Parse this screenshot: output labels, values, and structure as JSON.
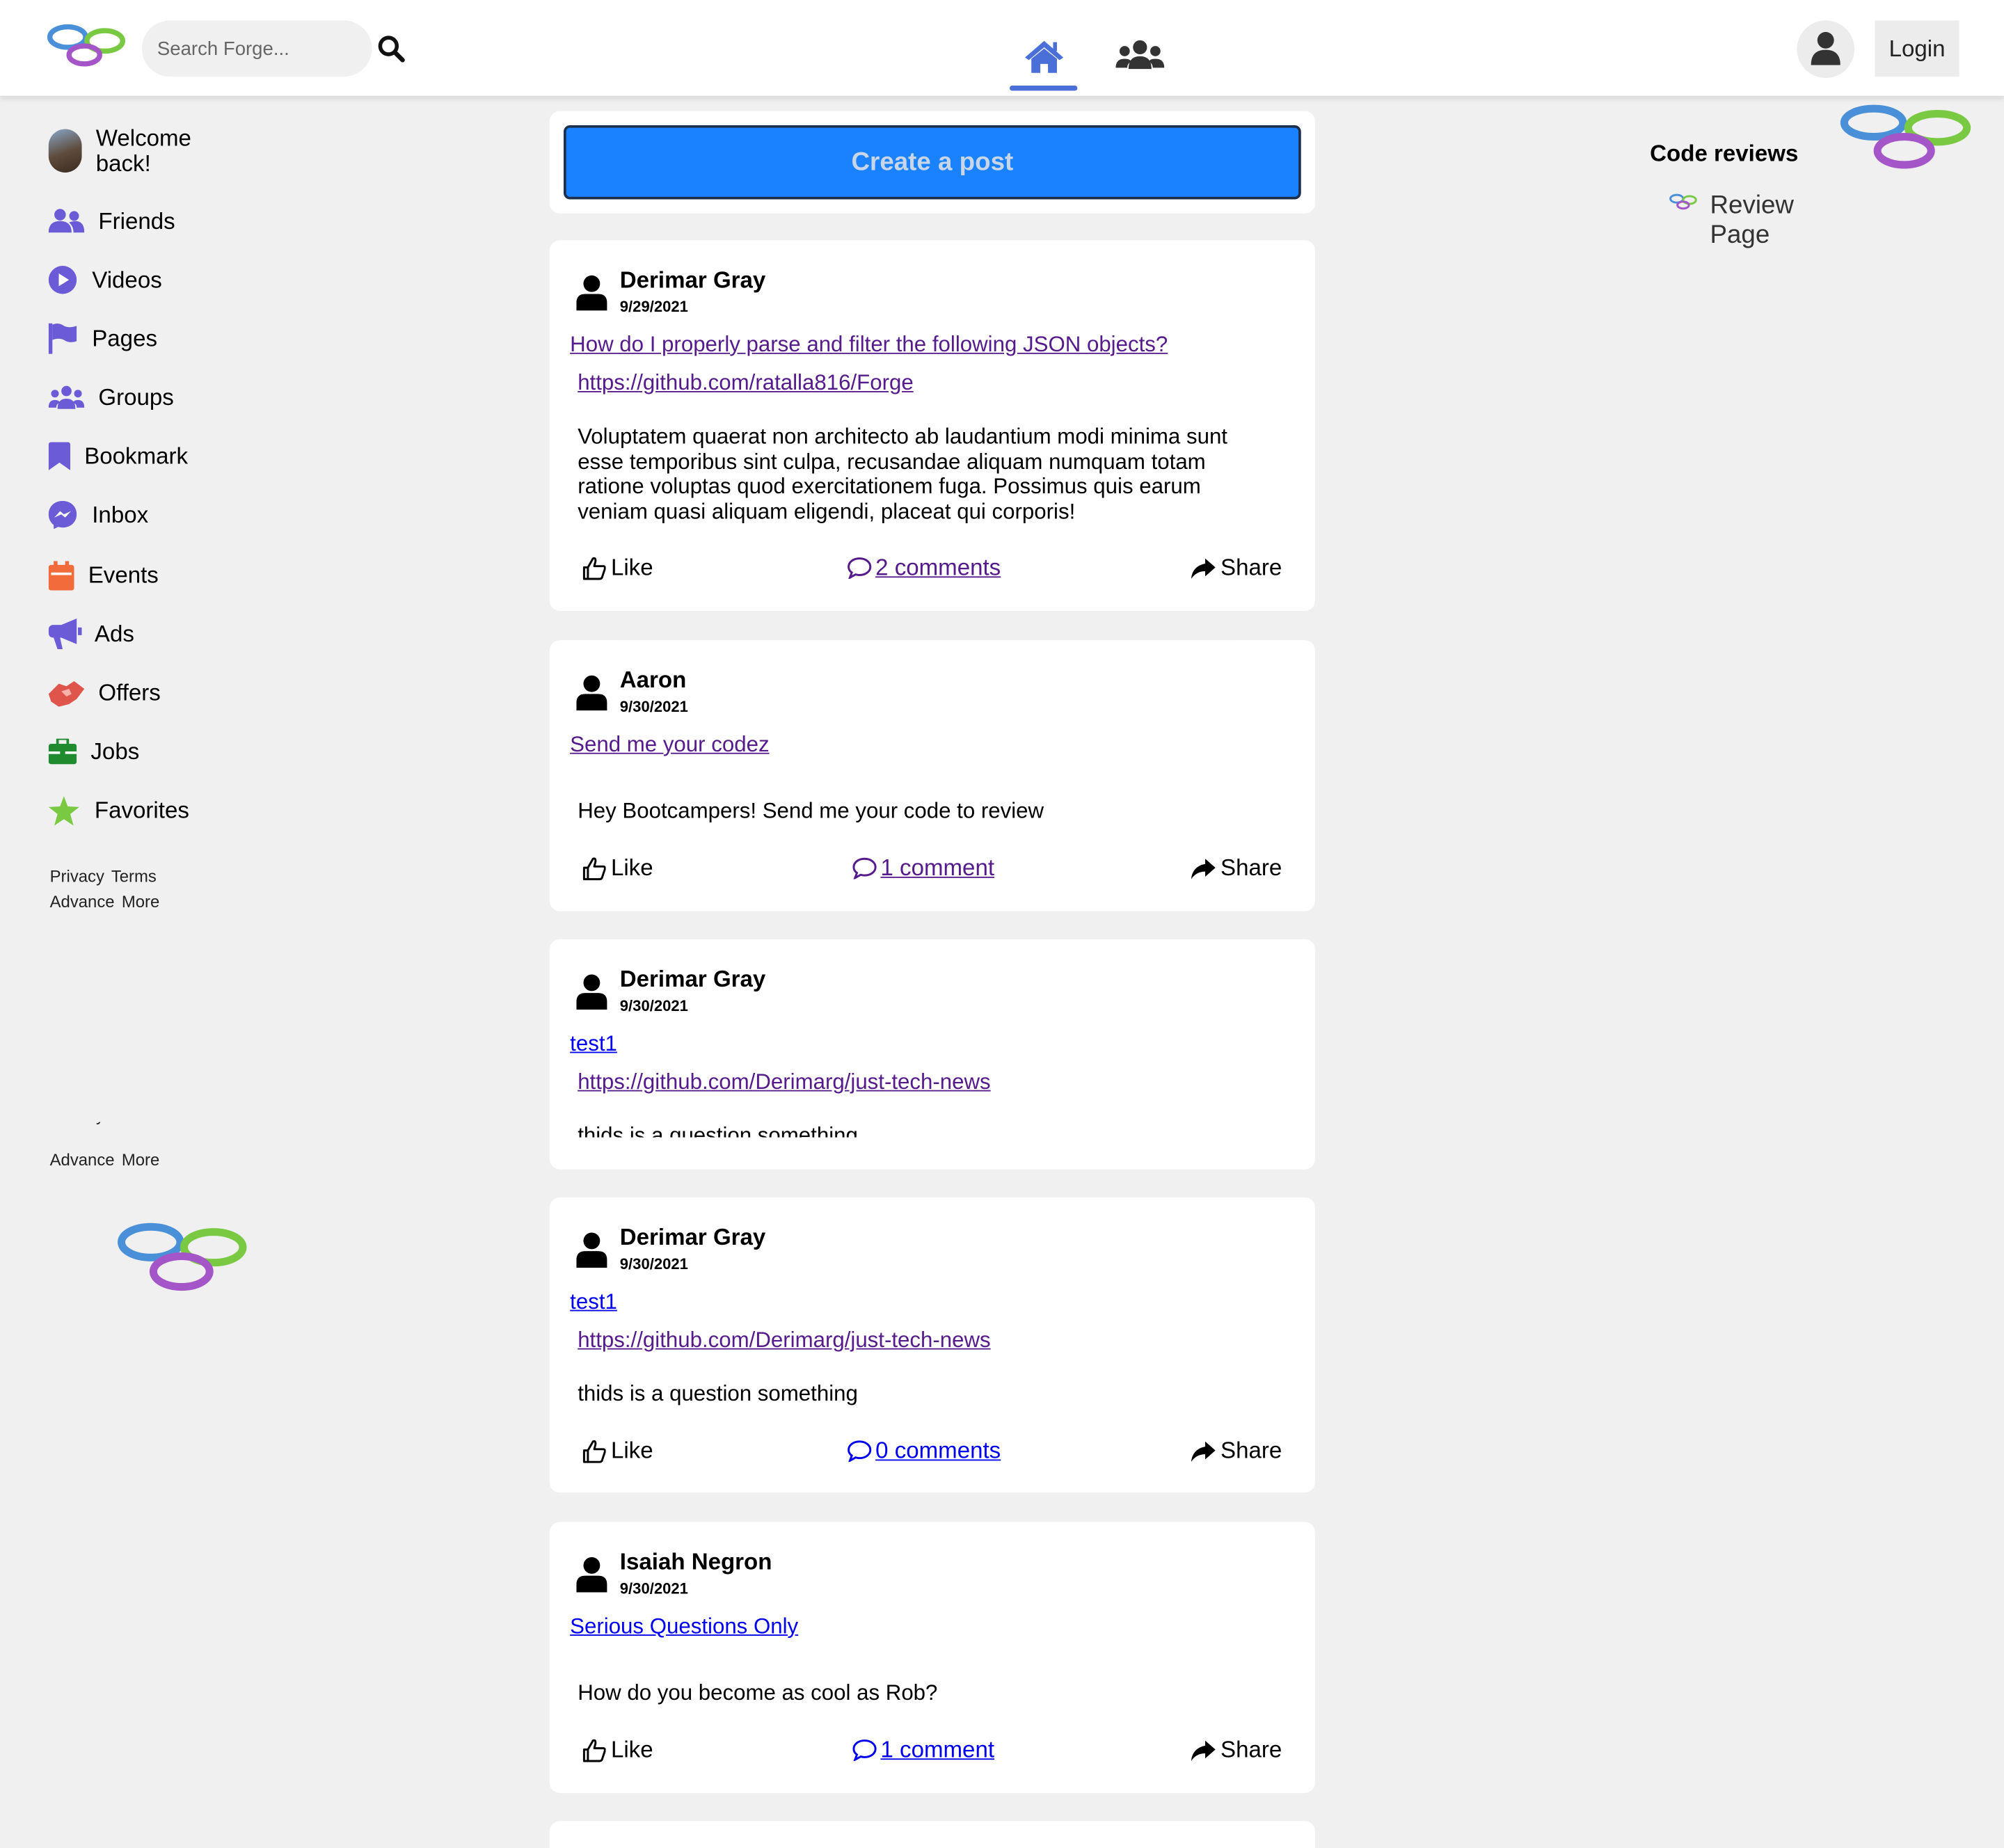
{
  "navbar": {
    "search_placeholder": "Search Forge...",
    "login_label": "Login"
  },
  "sidebar": {
    "welcome": "Welcome back!",
    "items": [
      {
        "label": "Friends",
        "icon": "user-friends-icon",
        "color": "#6b5bd6"
      },
      {
        "label": "Videos",
        "icon": "play-circle-icon",
        "color": "#6b5bd6"
      },
      {
        "label": "Pages",
        "icon": "flag-icon",
        "color": "#6b5bd6"
      },
      {
        "label": "Groups",
        "icon": "users-icon",
        "color": "#6b5bd6"
      },
      {
        "label": "Bookmark",
        "icon": "bookmark-icon",
        "color": "#6b5bd6"
      },
      {
        "label": "Inbox",
        "icon": "messenger-icon",
        "color": "#6b5bd6"
      },
      {
        "label": "Events",
        "icon": "calendar-icon",
        "color": "#f26b3a"
      },
      {
        "label": "Ads",
        "icon": "bullhorn-icon",
        "color": "#6b5bd6"
      },
      {
        "label": "Offers",
        "icon": "handshake-icon",
        "color": "#e0554b"
      },
      {
        "label": "Jobs",
        "icon": "briefcase-icon",
        "color": "#1f8a2e"
      },
      {
        "label": "Favorites",
        "icon": "star-icon",
        "color": "#7ac943"
      }
    ],
    "footer": {
      "privacy": "Privacy",
      "terms": "Terms",
      "advance": "Advance",
      "more": "More"
    }
  },
  "feed": {
    "create_post_label": "Create a post",
    "like_label": "Like",
    "share_label": "Share",
    "posts": [
      {
        "author": "Derimar Gray",
        "date": "9/29/2021",
        "title": "How do I properly parse and filter the following JSON objects?",
        "link": "https://github.com/ratalla816/Forge",
        "body": "Voluptatem quaerat non architecto ab laudantium modi minima sunt esse temporibus sint culpa, recusandae aliquam numquam totam ratione voluptas quod exercitationem fuga. Possimus quis earum veniam quasi aliquam eligendi, placeat qui corporis!",
        "comments": "2 comments"
      },
      {
        "author": "Aaron",
        "date": "9/30/2021",
        "title": "Send me your codez",
        "body": "Hey Bootcampers! Send me your code to review",
        "comments": "1 comment"
      },
      {
        "author": "Derimar Gray",
        "date": "9/30/2021",
        "title": "test1",
        "link": "https://github.com/Derimarg/just-tech-news",
        "body": "thids is a question something"
      },
      {
        "author": "Derimar Gray",
        "date": "9/30/2021",
        "title": "test1",
        "link": "https://github.com/Derimarg/just-tech-news",
        "body": "thids is a question something",
        "comments": "0 comments"
      },
      {
        "author": "Isaiah Negron",
        "date": "9/30/2021",
        "title": "Serious Questions Only",
        "body": "How do you become as cool as Rob?",
        "comments": "1 comment"
      }
    ]
  },
  "right": {
    "heading": "Code reviews",
    "review_link": "Review Page"
  }
}
